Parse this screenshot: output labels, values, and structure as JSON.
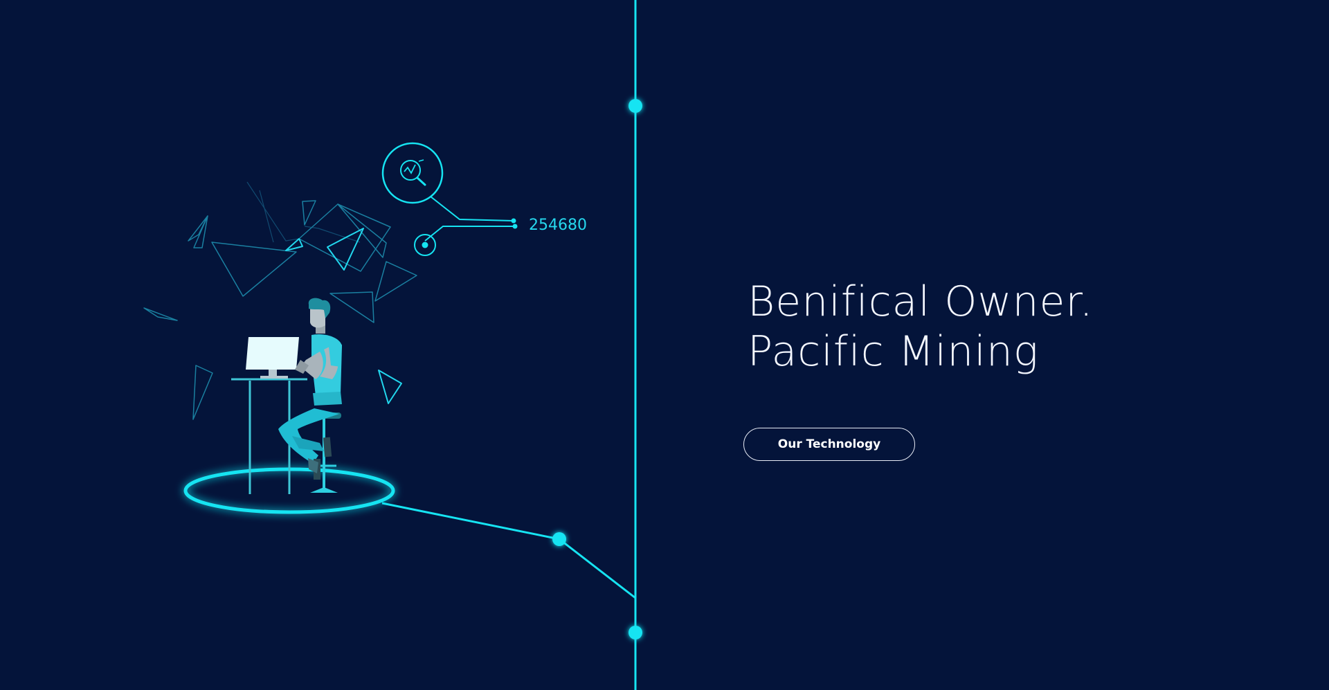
{
  "hero": {
    "line1": "Benifical Owner.",
    "line2": "Pacific Mining",
    "cta_label": "Our Technology"
  },
  "illustration": {
    "readout_value": "254680",
    "icons": [
      "search-chart-icon",
      "target-dot-icon"
    ]
  },
  "colors": {
    "background": "#04143a",
    "accent": "#16e4f2",
    "text": "#ffffff"
  }
}
